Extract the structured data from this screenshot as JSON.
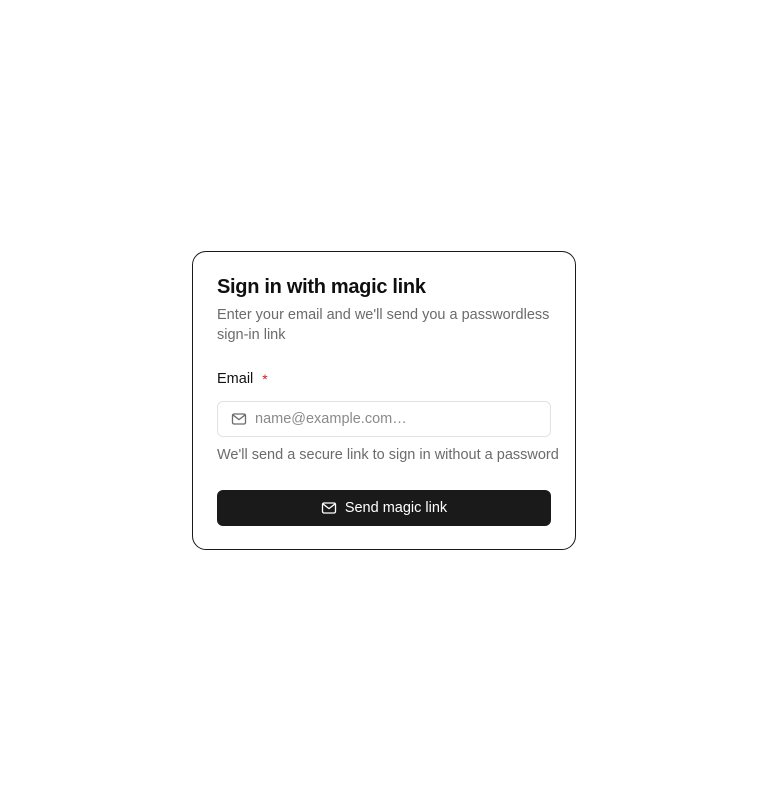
{
  "form": {
    "title": "Sign in with magic link",
    "subtitle": "Enter your email and we'll send you a passwordless sign-in link",
    "email_label": "Email",
    "required_mark": "*",
    "email_placeholder": "name@example.com…",
    "email_value": "",
    "email_icon": "mail-icon",
    "helper_text": "We'll send a secure link to sign in without a password",
    "submit_label": "Send magic link",
    "submit_icon": "mail-icon"
  },
  "colors": {
    "button_bg": "#1a1a1a",
    "required": "#d32020",
    "muted_text": "#6b6b6b",
    "card_border": "#1a1a1a",
    "input_border": "#e2e2e2"
  }
}
